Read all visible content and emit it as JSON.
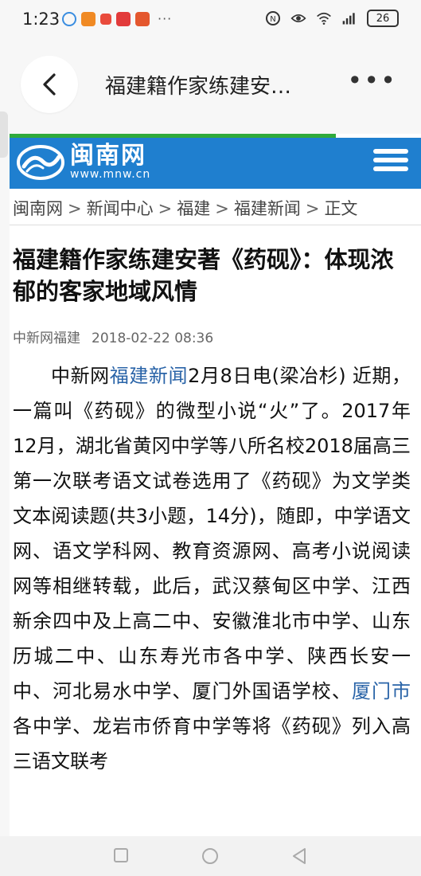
{
  "status": {
    "time": "1:23",
    "battery": "26"
  },
  "nav": {
    "title": "福建籍作家练建安…",
    "more": "•••"
  },
  "site": {
    "name": "闽南网",
    "url": "www.mnw.cn"
  },
  "breadcrumb": {
    "items": [
      "闽南网",
      "新闻中心",
      "福建",
      "福建新闻",
      "正文"
    ],
    "separator": ">"
  },
  "article": {
    "headline": "福建籍作家练建安著《药砚》：体现浓郁的客家地域风情",
    "source": "中新网福建",
    "datetime": "2018-02-22 08:36",
    "p1_a": "中新网",
    "p1_link1": "福建新闻",
    "p1_b": "2月8日电(梁冶杉) 近期，一篇叫《药砚》的微型小说“火”了。2017年12月，湖北省黄冈中学等八所名校2018届高三第一次联考语文试卷选用了《药砚》为文学类文本阅读题(共3小题，14分)，随即，中学语文网、语文学科网、教育资源网、高考小说阅读网等相继转载，此后，武汉蔡甸区中学、江西新余四中及上高二中、安徽淮北市中学、山东历城二中、山东寿光市各中学、陕西长安一中、河北易水中学、厦门外国语学校、",
    "p1_link2": "厦门市",
    "p1_c": "各中学、龙岩市侨育中学等将《药砚》列入高三语文联考"
  },
  "colors": {
    "header_blue": "#1f7fcf",
    "accent_green": "#2faa3b",
    "link_blue": "#2a64a8"
  }
}
